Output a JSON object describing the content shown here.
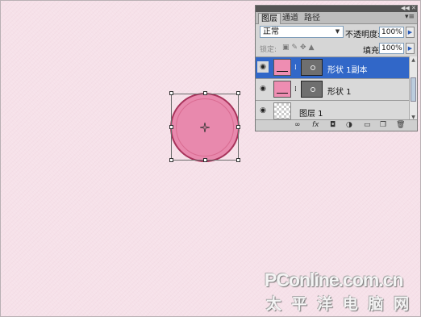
{
  "panel": {
    "tabs": [
      "图层",
      "通道",
      "路径"
    ],
    "blend_mode": "正常",
    "opacity_label": "不透明度:",
    "opacity_value": "100%",
    "lock_label": "锁定:",
    "fill_label": "填充:",
    "fill_value": "100%",
    "layers": [
      {
        "name": "形状 1副本",
        "type": "shape",
        "selected": true
      },
      {
        "name": "形状 1",
        "type": "shape",
        "selected": false
      },
      {
        "name": "图层 1",
        "type": "raster",
        "selected": false
      }
    ],
    "bottom_tools": [
      "link-icon",
      "fx-icon",
      "mask-icon",
      "adjustment-icon",
      "group-icon",
      "new-layer-icon",
      "trash-icon"
    ]
  },
  "canvas": {
    "shape_color": "#e889ad",
    "background_color": "#f6e1e9"
  },
  "watermark": {
    "line1": "PConline.com.cn",
    "line2": "太 平 洋 电 脑 网"
  }
}
